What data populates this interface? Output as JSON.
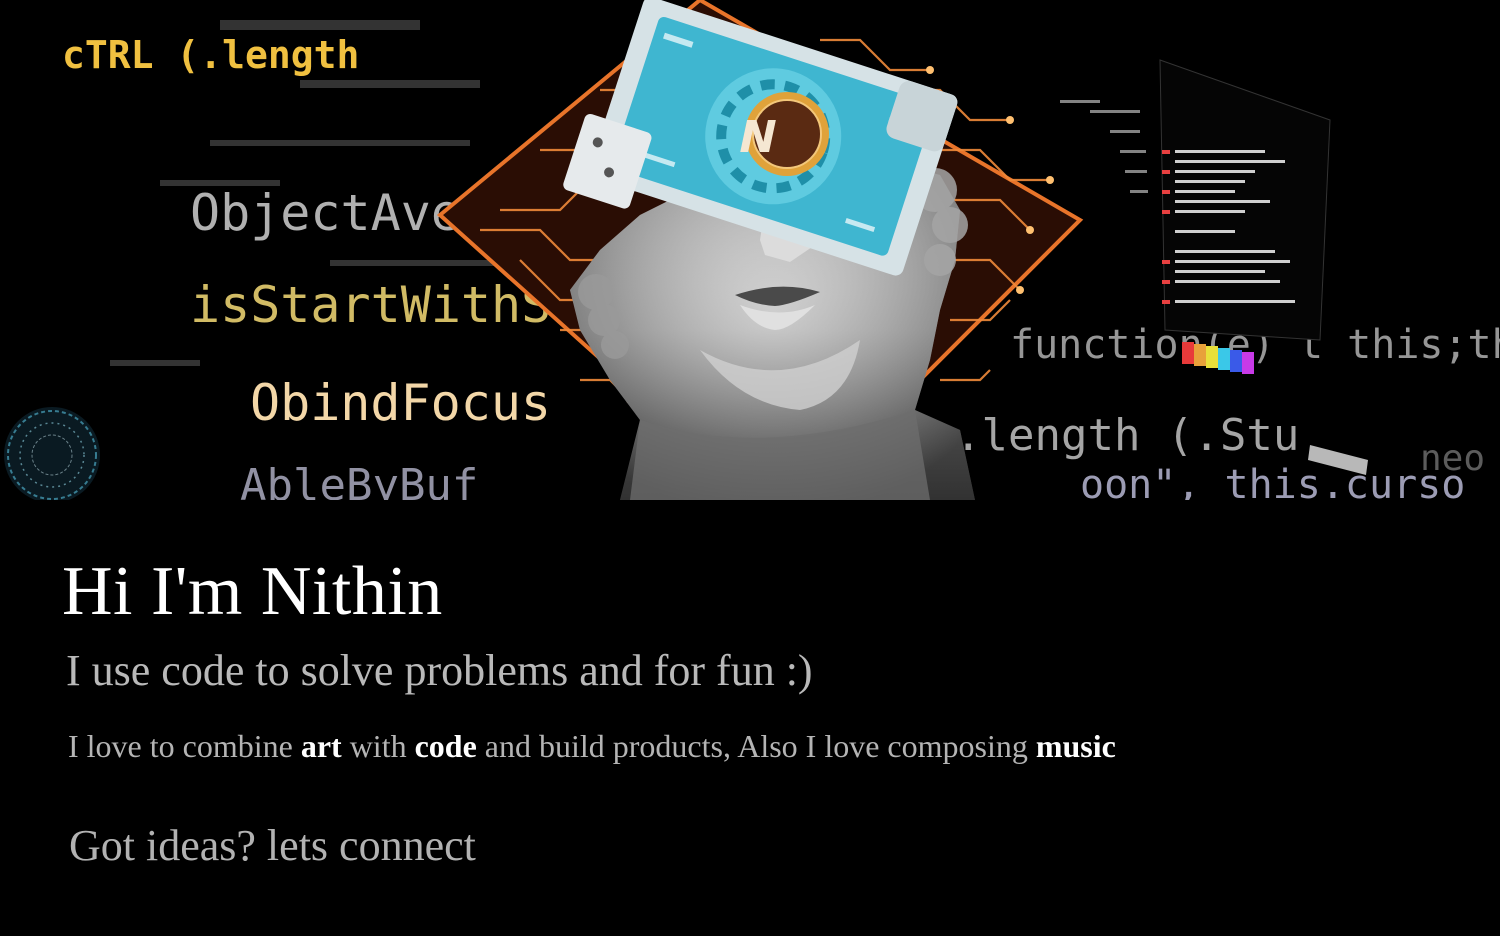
{
  "hero": {
    "code_fragments": [
      "cTRL (.length",
      "ObjectAverage",
      "isStartWithSubset",
      "ObindFocus",
      "AbleByBuf",
      "function(e) t this;th",
      ".length (.Stu",
      "oon\", this.curso",
      "neo"
    ],
    "logo_glyph": "N",
    "colors": {
      "circuit": "#e8742a",
      "circuit_bg": "#3a1206",
      "board": "#3fb6d0",
      "logo_ring": "#e0a23a",
      "logo_bg": "#5a2a12"
    }
  },
  "intro": {
    "headline": "Hi I'm Nithin",
    "tagline": "I use code to solve problems and for fun :)",
    "about": {
      "part1": "I love to combine ",
      "art": "art",
      "part2": " with ",
      "code": "code",
      "part3": " and build products, Also I love composing ",
      "music": "music"
    },
    "connect_label": "Got ideas? lets connect"
  }
}
